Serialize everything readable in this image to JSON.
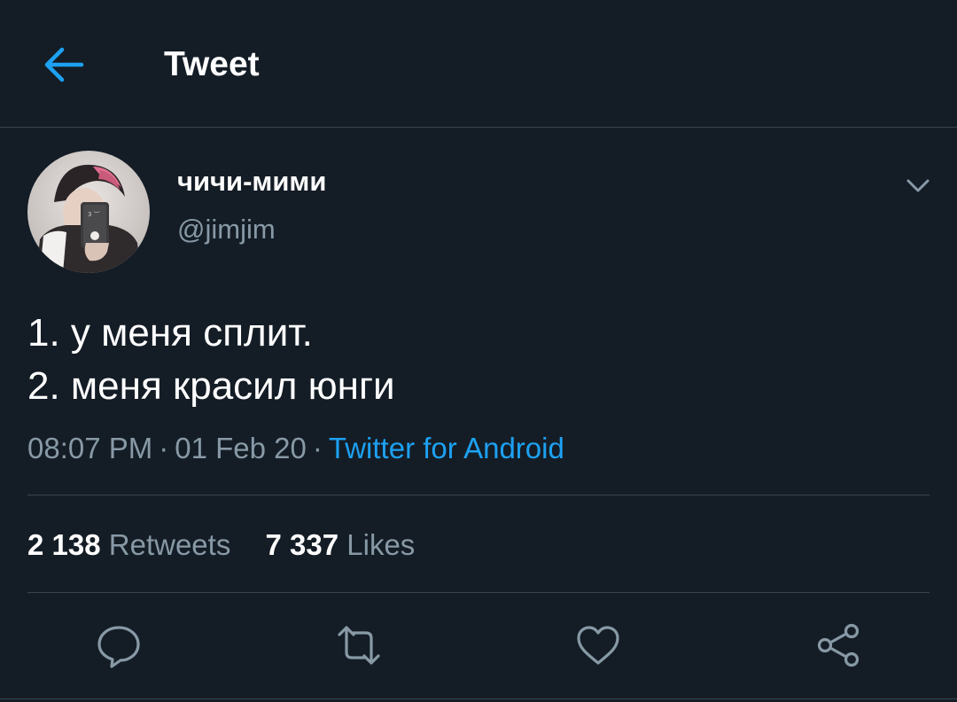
{
  "header": {
    "title": "Tweet",
    "back_icon": "arrow-left-icon"
  },
  "tweet": {
    "author": {
      "display_name": "чичи-мими",
      "handle": "@jimjim",
      "avatar": "user-avatar"
    },
    "text_lines": [
      "1. у меня сплит.",
      "2. меня красил юнги"
    ],
    "time": "08:07 PM",
    "date": "01 Feb 20",
    "separator": "·",
    "source": "Twitter for Android"
  },
  "stats": {
    "retweets_count": "2 138",
    "retweets_label": "Retweets",
    "likes_count": "7 337",
    "likes_label": "Likes"
  },
  "actions": {
    "reply_icon": "reply-icon",
    "retweet_icon": "retweet-icon",
    "like_icon": "heart-icon",
    "share_icon": "share-icon"
  },
  "colors": {
    "background": "#141d26",
    "accent": "#1da1f2",
    "secondary_text": "#8899a6",
    "divider": "#38444d"
  }
}
